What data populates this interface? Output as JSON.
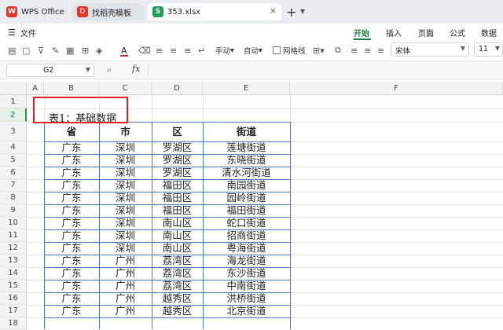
{
  "tabs": [
    {
      "label": "WPS Office",
      "icon": "wps-logo-icon"
    },
    {
      "label": "找稻壳模板",
      "icon": "docer-logo-icon"
    },
    {
      "label": "353.xlsx",
      "icon": "spreadsheet-icon",
      "close": "×"
    }
  ],
  "tabbar": {
    "new_tab": "+"
  },
  "menu": {
    "file": "文件",
    "tabs": [
      "开始",
      "插入",
      "页面",
      "公式",
      "数据"
    ],
    "active": "开始"
  },
  "toolbar": {
    "hand_label": "手动",
    "auto_label": "自动",
    "gridlines_label": "网格线",
    "font_name": "宋体",
    "font_size": "11",
    "font_color": "#e02020"
  },
  "formula_bar": {
    "cell_ref": "G2",
    "fx": "fx",
    "value": ""
  },
  "sheet": {
    "columns": [
      "A",
      "B",
      "C",
      "D",
      "E",
      "F"
    ],
    "rows": [
      "1",
      "2",
      "3",
      "4",
      "5",
      "6",
      "7",
      "8",
      "9",
      "10",
      "11",
      "12",
      "13",
      "14",
      "15",
      "16",
      "17",
      "18"
    ],
    "title": "表1：基础数据",
    "headers": [
      "省",
      "市",
      "区",
      "街道"
    ],
    "data": [
      [
        "广东",
        "深圳",
        "罗湖区",
        "莲塘街道"
      ],
      [
        "广东",
        "深圳",
        "罗湖区",
        "东晓街道"
      ],
      [
        "广东",
        "深圳",
        "罗湖区",
        "清水河街道"
      ],
      [
        "广东",
        "深圳",
        "福田区",
        "南园街道"
      ],
      [
        "广东",
        "深圳",
        "福田区",
        "园岭街道"
      ],
      [
        "广东",
        "深圳",
        "福田区",
        "福田街道"
      ],
      [
        "广东",
        "深圳",
        "南山区",
        "蛇口街道"
      ],
      [
        "广东",
        "深圳",
        "南山区",
        "招商街道"
      ],
      [
        "广东",
        "深圳",
        "南山区",
        "粤海街道"
      ],
      [
        "广东",
        "广州",
        "荔湾区",
        "海龙街道"
      ],
      [
        "广东",
        "广州",
        "荔湾区",
        "东沙街道"
      ],
      [
        "广东",
        "广州",
        "荔湾区",
        "中南街道"
      ],
      [
        "广东",
        "广州",
        "越秀区",
        "洪桥街道"
      ],
      [
        "广东",
        "广州",
        "越秀区",
        "北京街道"
      ]
    ],
    "selected_row": "2",
    "highlight_color": "#e02020",
    "table_border_color": "#4a78c6"
  }
}
